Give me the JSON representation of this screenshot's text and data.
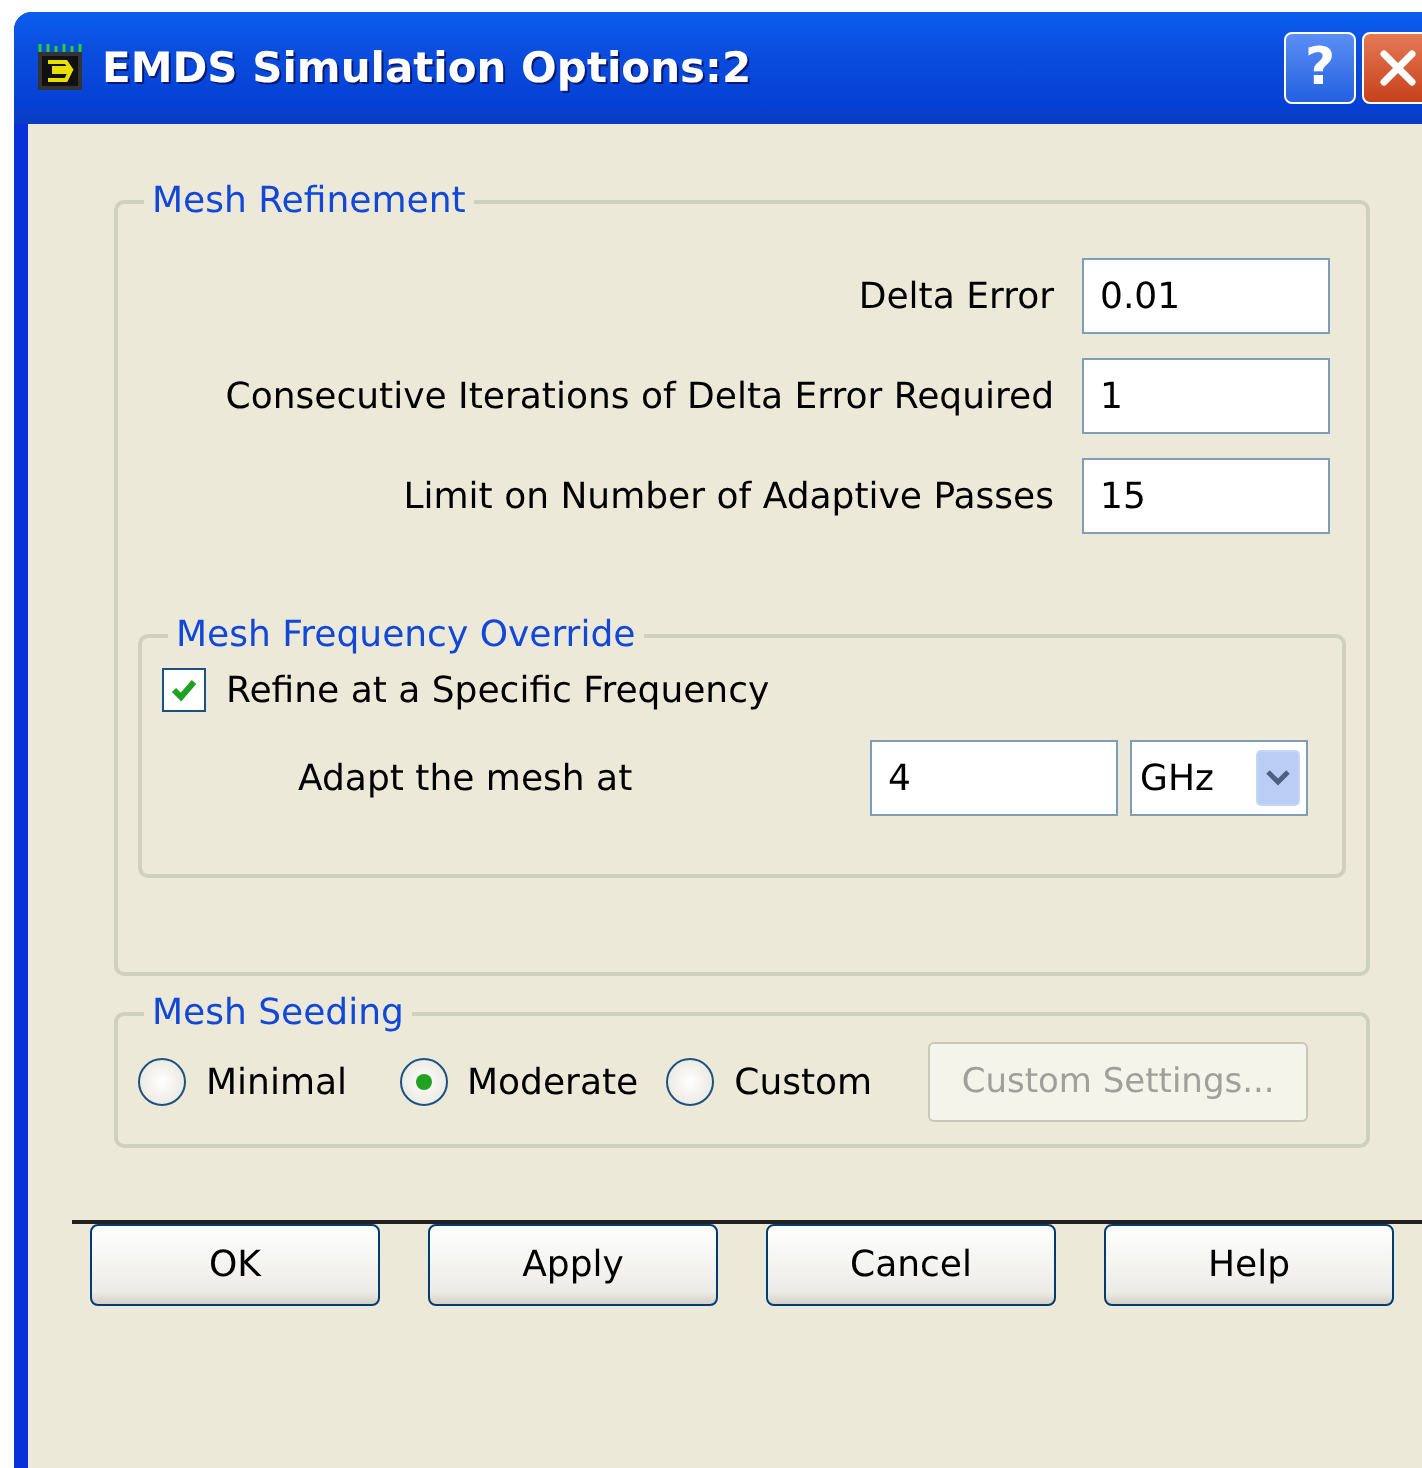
{
  "window": {
    "title": "EMDS Simulation Options:2",
    "help_glyph": "?"
  },
  "mesh_refinement": {
    "legend": "Mesh Refinement",
    "fields": [
      {
        "label": "Delta Error",
        "value": "0.01"
      },
      {
        "label": "Consecutive Iterations of Delta Error Required",
        "value": "1"
      },
      {
        "label": "Limit on Number of Adaptive Passes",
        "value": "15"
      }
    ],
    "frequency_override": {
      "legend": "Mesh Frequency Override",
      "checkbox": {
        "label": "Refine at a Specific Frequency",
        "checked": true
      },
      "adapt": {
        "label": "Adapt the mesh at",
        "value": "4",
        "unit": "GHz"
      }
    }
  },
  "mesh_seeding": {
    "legend": "Mesh Seeding",
    "options": [
      {
        "label": "Minimal",
        "selected": false
      },
      {
        "label": "Moderate",
        "selected": true
      },
      {
        "label": "Custom",
        "selected": false
      }
    ],
    "custom_button": {
      "label": "Custom Settings...",
      "disabled": true
    }
  },
  "buttons": [
    "OK",
    "Apply",
    "Cancel",
    "Help"
  ]
}
